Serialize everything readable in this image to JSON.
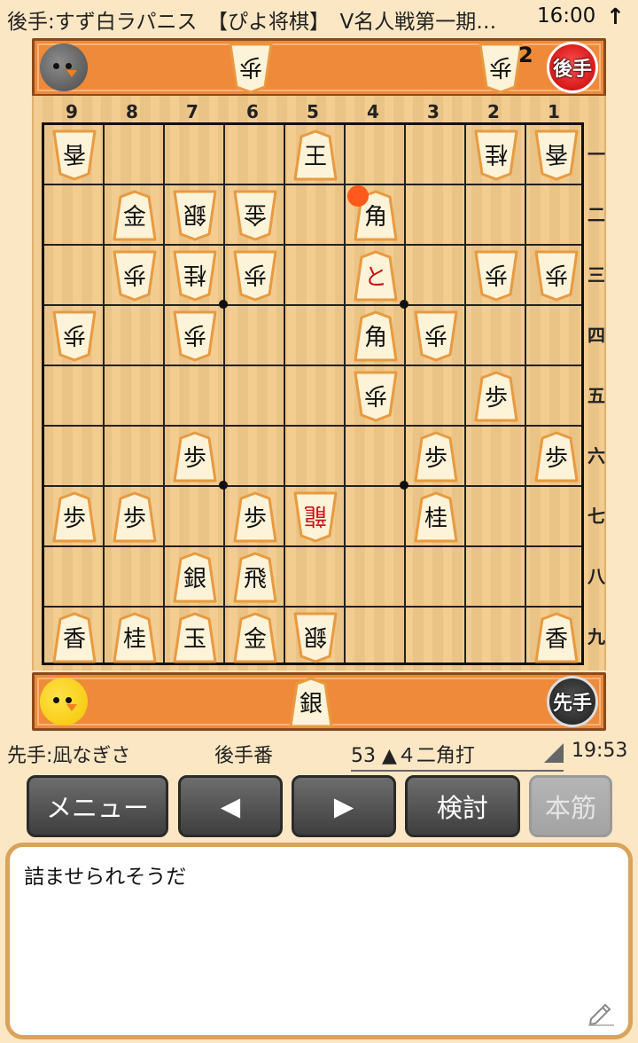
{
  "status_bar": {
    "title": "後手:すず白ラパニス　【ぴよ将棋】　V名人戦第一期…",
    "time": "16:00",
    "arrow_icon": "up-arrow-icon"
  },
  "gote_stand": {
    "badge": "後手",
    "hand": [
      {
        "piece": "歩",
        "count": ""
      },
      {
        "piece": "歩",
        "count": "2"
      }
    ]
  },
  "sente_stand": {
    "badge": "先手",
    "hand": [
      {
        "piece": "銀",
        "count": ""
      }
    ]
  },
  "board": {
    "col_labels": [
      "9",
      "8",
      "7",
      "6",
      "5",
      "4",
      "3",
      "2",
      "1"
    ],
    "row_labels": [
      "一",
      "二",
      "三",
      "四",
      "五",
      "六",
      "七",
      "八",
      "九"
    ],
    "pieces": [
      {
        "col": 9,
        "row": 1,
        "text": "香",
        "owner": "gote"
      },
      {
        "col": 5,
        "row": 1,
        "text": "王",
        "owner": "sente"
      },
      {
        "col": 2,
        "row": 1,
        "text": "桂",
        "owner": "gote"
      },
      {
        "col": 1,
        "row": 1,
        "text": "香",
        "owner": "gote"
      },
      {
        "col": 8,
        "row": 2,
        "text": "金",
        "owner": "sente"
      },
      {
        "col": 7,
        "row": 2,
        "text": "銀",
        "owner": "gote"
      },
      {
        "col": 6,
        "row": 2,
        "text": "金",
        "owner": "gote"
      },
      {
        "col": 4,
        "row": 2,
        "text": "角",
        "owner": "sente"
      },
      {
        "col": 8,
        "row": 3,
        "text": "歩",
        "owner": "gote"
      },
      {
        "col": 7,
        "row": 3,
        "text": "桂",
        "owner": "gote"
      },
      {
        "col": 6,
        "row": 3,
        "text": "歩",
        "owner": "gote"
      },
      {
        "col": 4,
        "row": 3,
        "text": "と",
        "owner": "sente",
        "promoted": true
      },
      {
        "col": 2,
        "row": 3,
        "text": "歩",
        "owner": "gote"
      },
      {
        "col": 1,
        "row": 3,
        "text": "歩",
        "owner": "gote"
      },
      {
        "col": 9,
        "row": 4,
        "text": "歩",
        "owner": "gote"
      },
      {
        "col": 7,
        "row": 4,
        "text": "歩",
        "owner": "gote"
      },
      {
        "col": 4,
        "row": 4,
        "text": "角",
        "owner": "sente"
      },
      {
        "col": 3,
        "row": 4,
        "text": "歩",
        "owner": "gote"
      },
      {
        "col": 4,
        "row": 5,
        "text": "歩",
        "owner": "gote"
      },
      {
        "col": 2,
        "row": 5,
        "text": "歩",
        "owner": "sente"
      },
      {
        "col": 7,
        "row": 6,
        "text": "歩",
        "owner": "sente"
      },
      {
        "col": 3,
        "row": 6,
        "text": "歩",
        "owner": "sente"
      },
      {
        "col": 1,
        "row": 6,
        "text": "歩",
        "owner": "sente"
      },
      {
        "col": 9,
        "row": 7,
        "text": "歩",
        "owner": "sente"
      },
      {
        "col": 8,
        "row": 7,
        "text": "歩",
        "owner": "sente"
      },
      {
        "col": 6,
        "row": 7,
        "text": "歩",
        "owner": "sente"
      },
      {
        "col": 5,
        "row": 7,
        "text": "龍",
        "owner": "gote",
        "promoted": true
      },
      {
        "col": 3,
        "row": 7,
        "text": "桂",
        "owner": "sente"
      },
      {
        "col": 7,
        "row": 8,
        "text": "銀",
        "owner": "sente"
      },
      {
        "col": 6,
        "row": 8,
        "text": "飛",
        "owner": "sente"
      },
      {
        "col": 9,
        "row": 9,
        "text": "香",
        "owner": "sente"
      },
      {
        "col": 8,
        "row": 9,
        "text": "桂",
        "owner": "sente"
      },
      {
        "col": 7,
        "row": 9,
        "text": "玉",
        "owner": "sente"
      },
      {
        "col": 6,
        "row": 9,
        "text": "金",
        "owner": "sente"
      },
      {
        "col": 5,
        "row": 9,
        "text": "銀",
        "owner": "gote"
      },
      {
        "col": 1,
        "row": 9,
        "text": "香",
        "owner": "sente"
      }
    ],
    "last_move": {
      "col": 4,
      "row": 2
    }
  },
  "info": {
    "sente_player": "先手:凪なぎさ",
    "turn": "後手番",
    "move": "53 ▲４二角打",
    "clock": "19:53"
  },
  "buttons": {
    "menu": "メニュー",
    "prev": "◀",
    "next": "▶",
    "analyze": "検討",
    "mainline": "本筋"
  },
  "comment": {
    "text": "詰ませられそうだ",
    "edit_icon": "pencil-icon"
  },
  "colors": {
    "background": "#fbe7c3",
    "stand": "#ee8a3a",
    "board": "#f2c98a",
    "piece_face": "#fdf3d8",
    "piece_border": "#e89a40",
    "promoted_text": "#c8141a",
    "last_move_dot": "#ff5a1e"
  }
}
